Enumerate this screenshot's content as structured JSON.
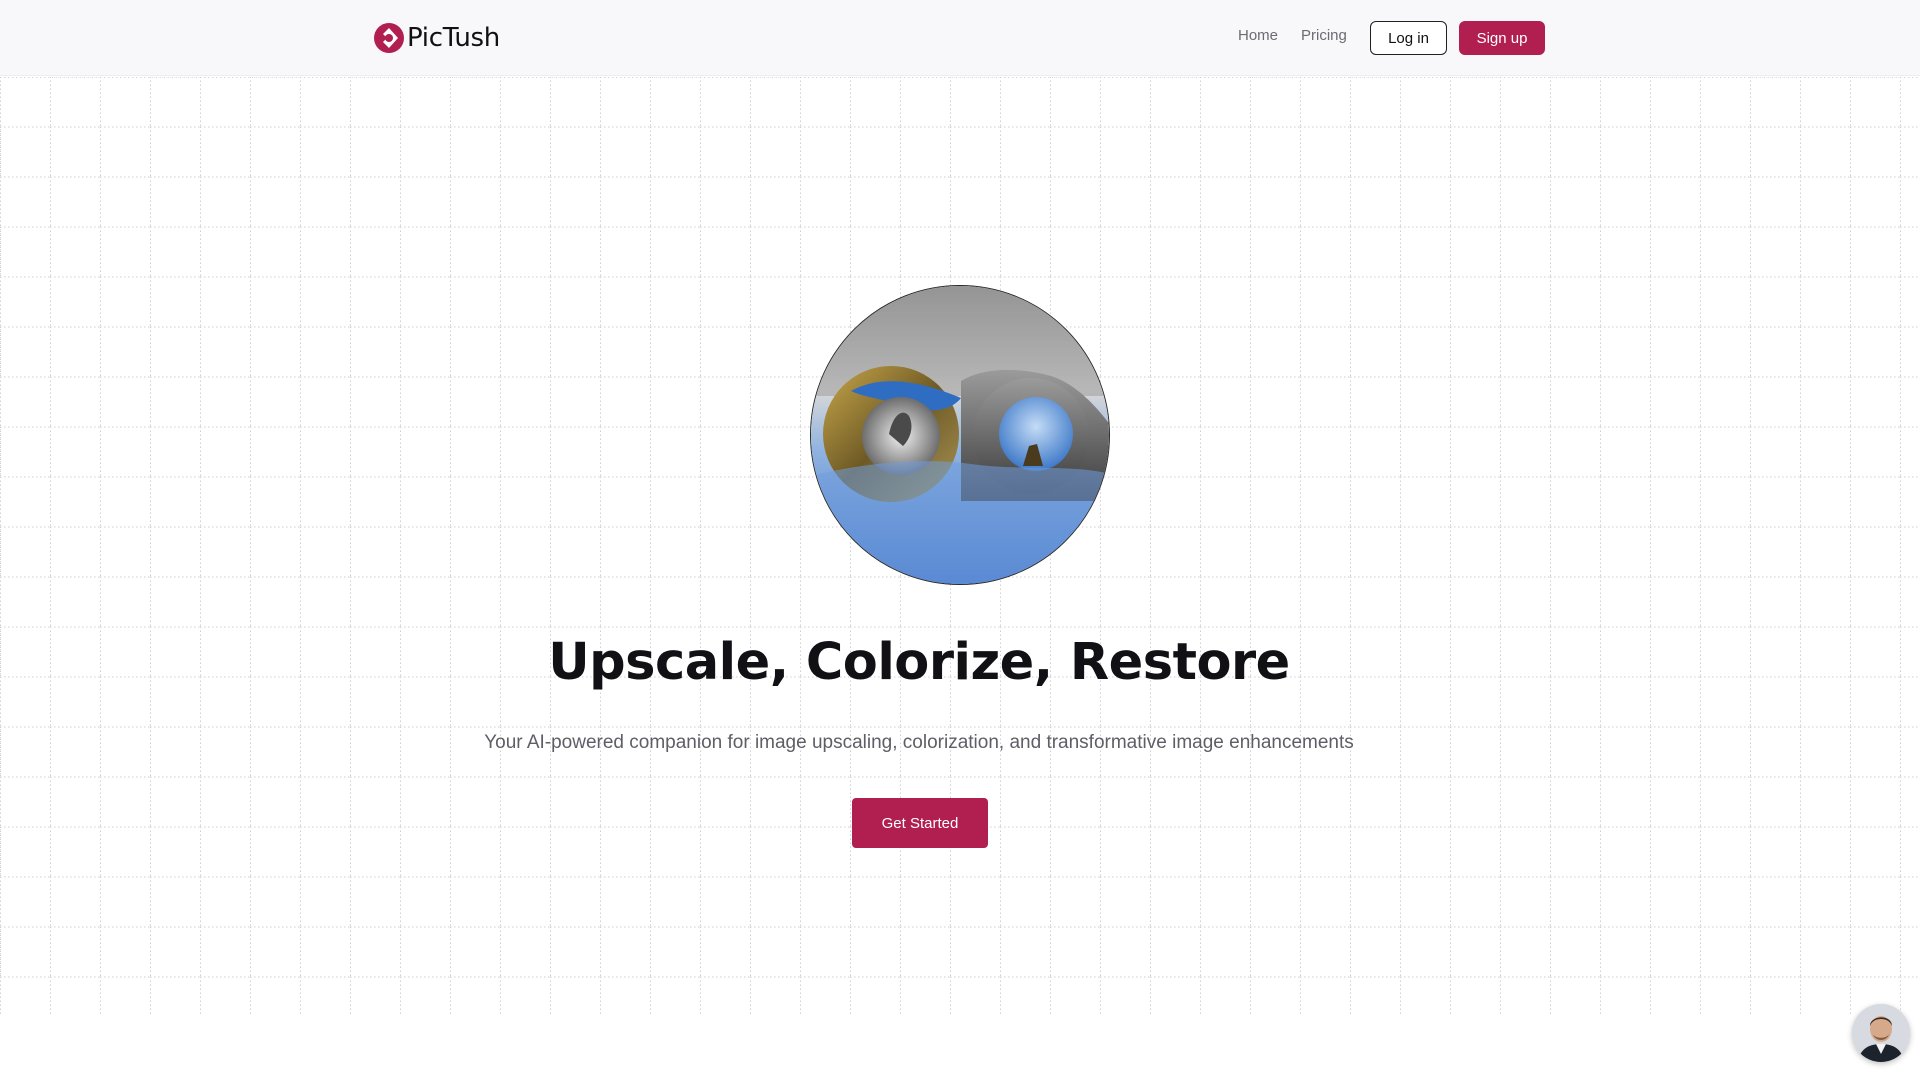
{
  "header": {
    "brand": "PicTush",
    "nav": {
      "home": "Home",
      "pricing": "Pricing"
    },
    "login_label": "Log in",
    "signup_label": "Sign up"
  },
  "hero": {
    "title": "Upscale, Colorize, Restore",
    "subtitle": "Your AI-powered companion for image upscaling, colorization, and transformative image enhancements",
    "cta_label": "Get Started"
  },
  "colors": {
    "brand": "#b11f50",
    "text_dark": "#111115",
    "text_muted": "#5e5e66",
    "header_bg": "#f8f8fb"
  },
  "icons": {
    "logo": "pictush-logo-icon",
    "chat": "support-avatar-icon"
  }
}
